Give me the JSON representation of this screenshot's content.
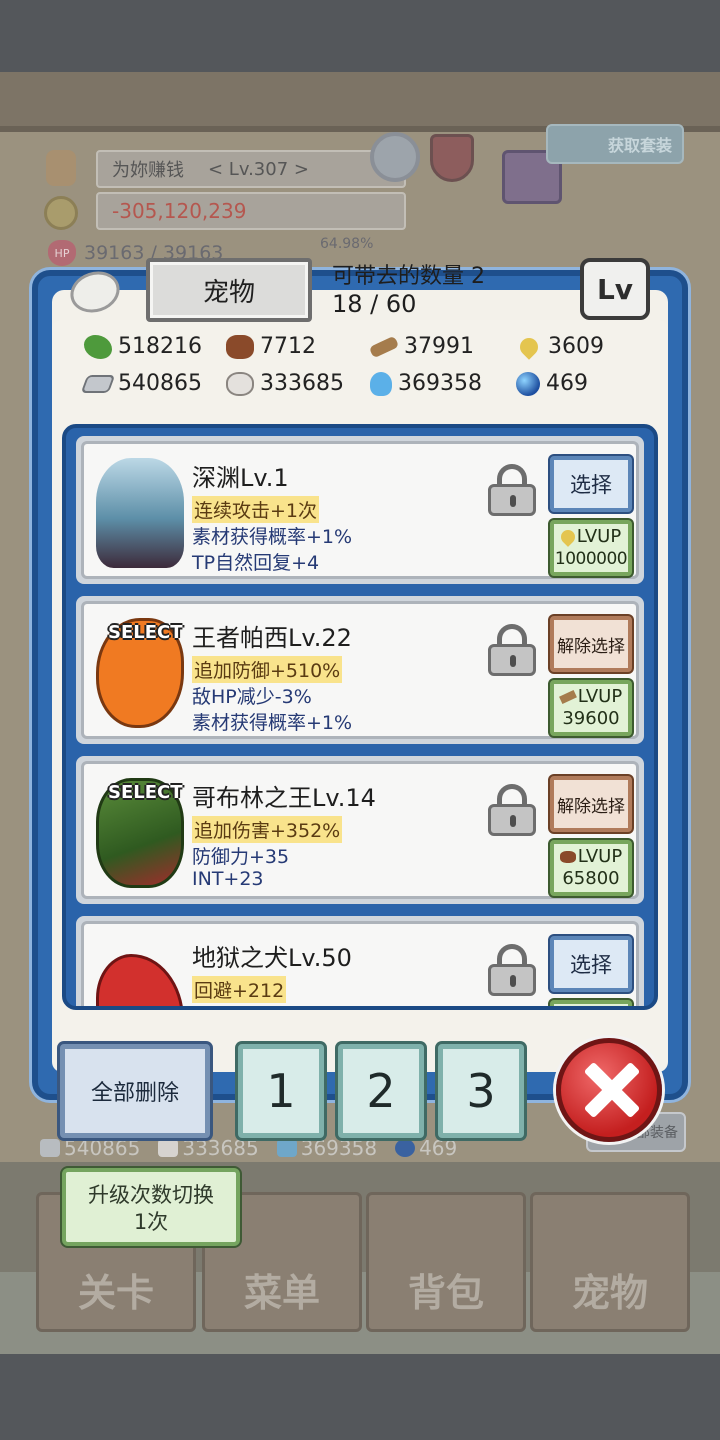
{
  "hud": {
    "player_name": "为妳赚钱",
    "player_level": "< Lv.307 >",
    "money": "-305,120,239",
    "hp": "39163 / 39163",
    "exp_percent": "64.98%",
    "get_set_label": "获取套装"
  },
  "modal": {
    "title": "宠物",
    "carry_label": "可带去的数量 2",
    "carry_count": "18 / 60",
    "lv_lock_label": "Lv",
    "resources": [
      {
        "icon": "herb-icon",
        "value": "518216"
      },
      {
        "icon": "wood-log-icon",
        "value": "7712"
      },
      {
        "icon": "plank-icon",
        "value": "37991"
      },
      {
        "icon": "drop-icon",
        "value": "3609"
      },
      {
        "icon": "ingot-icon",
        "value": "540865"
      },
      {
        "icon": "stone-icon",
        "value": "333685"
      },
      {
        "icon": "flame-icon",
        "value": "369358"
      },
      {
        "icon": "orb-icon",
        "value": "469"
      }
    ],
    "pets": [
      {
        "name": "深渊Lv.1",
        "selected": "",
        "stats": [
          "连续攻击+1次",
          "素材获得概率+1%",
          "TP自然回复+4"
        ],
        "action": "选择",
        "lvup_label": "LVUP",
        "lvup_cost": "1000000"
      },
      {
        "name": "王者帕西Lv.22",
        "selected": "SELECT",
        "stats": [
          "追加防御+510%",
          "敌HP减少-3%",
          "素材获得概率+1%"
        ],
        "action": "解除选择",
        "lvup_label": "LVUP",
        "lvup_cost": "39600"
      },
      {
        "name": "哥布林之王Lv.14",
        "selected": "SELECT",
        "stats": [
          "追加伤害+352%",
          "防御力+35",
          "INT+23"
        ],
        "action": "解除选择",
        "lvup_label": "LVUP",
        "lvup_cost": "65800"
      },
      {
        "name": "地狱之犬Lv.50",
        "selected": "",
        "stats": [
          "回避+212"
        ],
        "action": "选择"
      }
    ],
    "delete_all": "全部删除",
    "slots": [
      "1",
      "2",
      "3"
    ]
  },
  "background": {
    "resources": [
      "540865",
      "333685",
      "369358",
      "469"
    ],
    "unequip_label": "解除全部装备",
    "upgrade_toggle_line1": "升级次数切换",
    "upgrade_toggle_line2": "1次",
    "nav": [
      "关卡",
      "菜单",
      "背包",
      "宠物"
    ]
  }
}
